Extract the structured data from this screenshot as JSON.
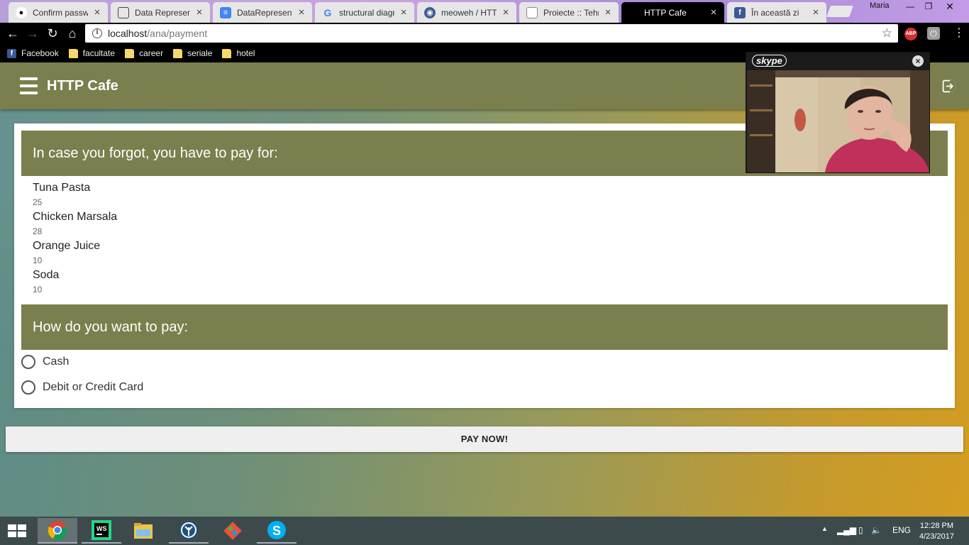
{
  "browser": {
    "tabs": [
      {
        "title": "Confirm passwo",
        "icon": "github-icon",
        "active": false
      },
      {
        "title": "Data Represent",
        "icon": "doc-icon",
        "active": false
      },
      {
        "title": "DataRepresenta",
        "icon": "google-docs-icon",
        "active": false
      },
      {
        "title": "structural diagr",
        "icon": "google-icon",
        "active": false
      },
      {
        "title": "meoweh / HTTP",
        "icon": "repo-icon",
        "active": false
      },
      {
        "title": "Proiecte :: Tehn",
        "icon": "page-icon",
        "active": false
      },
      {
        "title": "HTTP Cafe",
        "icon": "none",
        "active": true
      },
      {
        "title": "În această zi",
        "icon": "facebook-icon",
        "active": false
      }
    ],
    "profile_name": "Maria",
    "url_host": "localhost",
    "url_path": "/ana/payment",
    "bookmarks": [
      {
        "label": "Facebook",
        "icon": "facebook-icon"
      },
      {
        "label": "facultate",
        "icon": "folder-icon"
      },
      {
        "label": "career",
        "icon": "folder-icon"
      },
      {
        "label": "seriale",
        "icon": "folder-icon"
      },
      {
        "label": "hotel",
        "icon": "folder-icon"
      }
    ]
  },
  "app": {
    "title": "HTTP Cafe",
    "accent_color": "#7b7f4d"
  },
  "order": {
    "heading": "In case you forgot, you have to pay for:",
    "items": [
      {
        "name": "Tuna Pasta",
        "price": "25"
      },
      {
        "name": "Chicken Marsala",
        "price": "28"
      },
      {
        "name": "Orange Juice",
        "price": "10"
      },
      {
        "name": "Soda",
        "price": "10"
      }
    ]
  },
  "payment": {
    "heading": "How do you want to pay:",
    "options": [
      "Cash",
      "Debit or Credit Card"
    ],
    "submit_label": "PAY NOW!"
  },
  "skype": {
    "logo_text": "skype"
  },
  "taskbar": {
    "apps": [
      "chrome-icon",
      "webstorm-icon",
      "file-explorer-icon",
      "sourcetree-icon",
      "git-icon",
      "skype-icon"
    ],
    "language": "ENG",
    "time": "12:28 PM",
    "date": "4/23/2017"
  }
}
